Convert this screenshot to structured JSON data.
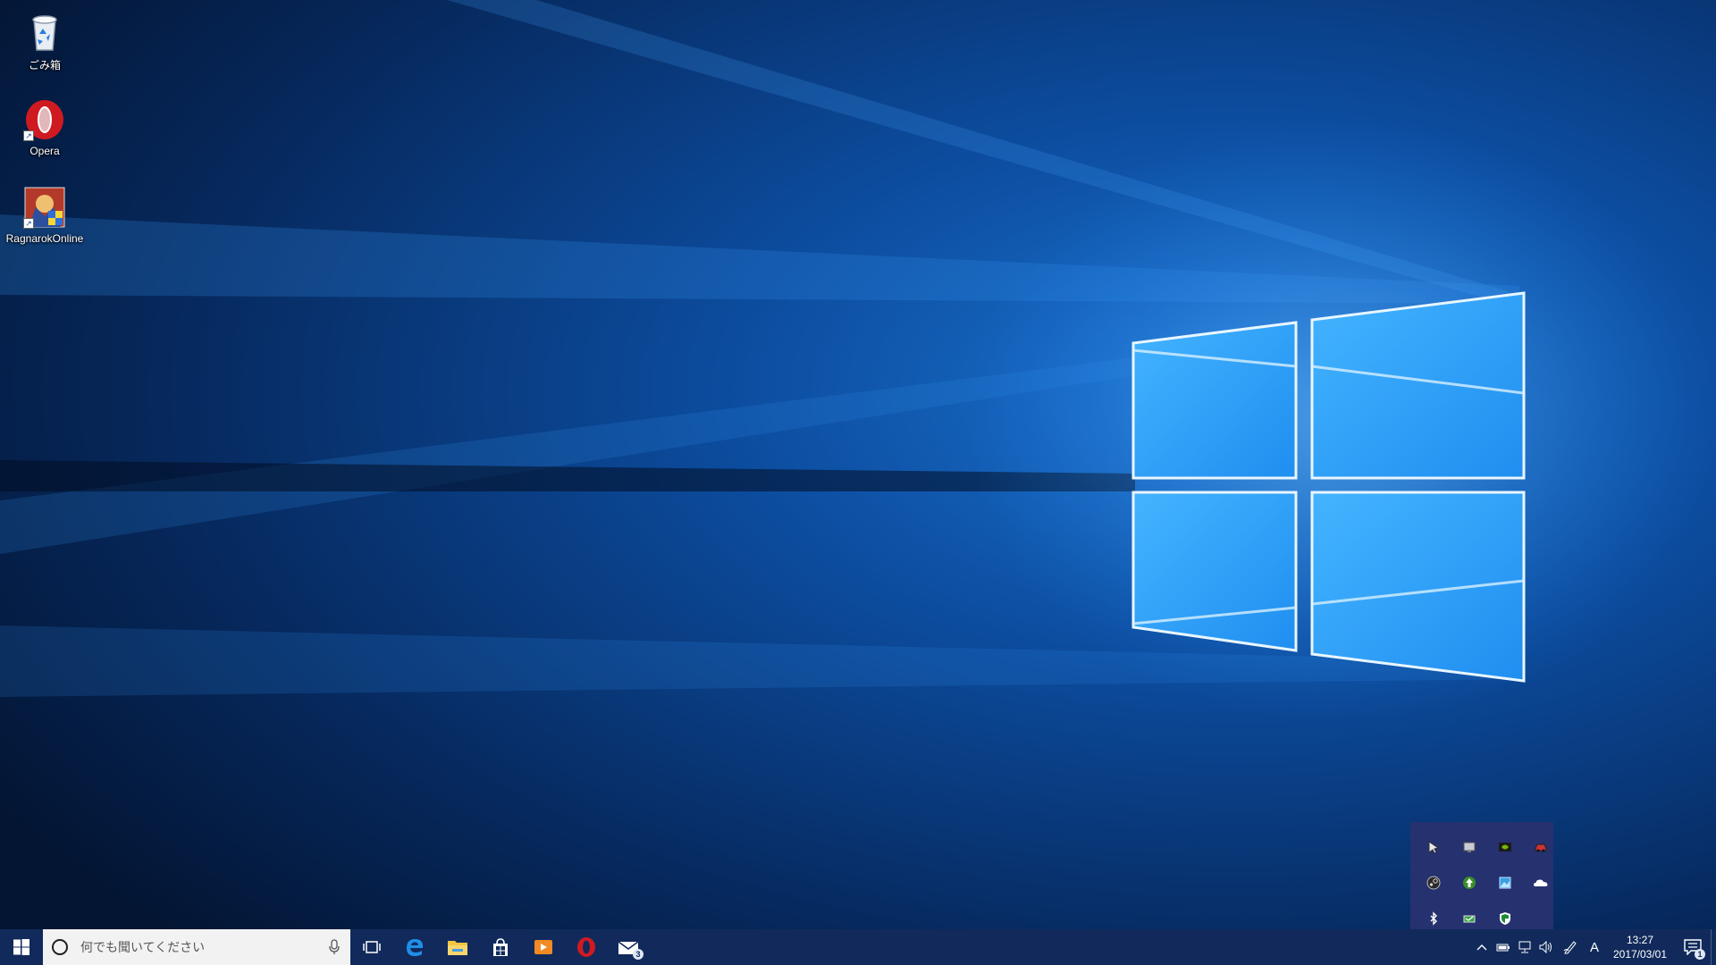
{
  "desktop": {
    "icons": [
      {
        "label": "ごみ箱",
        "icon": "recycle-bin-icon"
      },
      {
        "label": "Opera",
        "icon": "opera-icon"
      },
      {
        "label": "RagnarokOnline",
        "icon": "ragnarok-online-icon"
      }
    ]
  },
  "taskbar": {
    "search": {
      "placeholder": "何でも聞いてください",
      "icon": "cortana-circle-icon"
    },
    "pinned": [
      {
        "name": "task-view",
        "icon": "task-view-icon"
      },
      {
        "name": "edge",
        "icon": "edge-icon"
      },
      {
        "name": "file-explorer",
        "icon": "folder-icon"
      },
      {
        "name": "store",
        "icon": "store-icon"
      },
      {
        "name": "media-player",
        "icon": "media-player-icon"
      },
      {
        "name": "opera",
        "icon": "opera-icon"
      },
      {
        "name": "mail",
        "icon": "mail-icon",
        "badge": "3"
      }
    ],
    "tray": {
      "input_indicator": "A",
      "clock_time": "13:27",
      "clock_date": "2017/03/01",
      "notification_badge": "1"
    }
  },
  "tray_popup": {
    "icons": [
      "mouse-icon",
      "display-icon",
      "nvidia-icon",
      "car-icon",
      "steam-icon",
      "arrow-up-icon",
      "picture-icon",
      "onedrive-icon",
      "bluetooth-icon",
      "network-icon",
      "defender-icon"
    ]
  },
  "colors": {
    "taskbar": "#112a5b",
    "popup": "#26316f",
    "wallpaper_dark": "#05204a",
    "wallpaper_glow": "#1e8cff"
  }
}
